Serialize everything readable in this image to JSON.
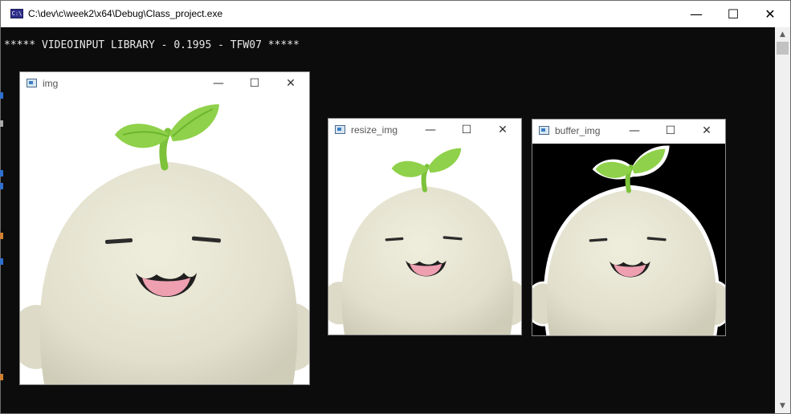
{
  "console": {
    "title": "C:\\dev\\c\\week2\\x64\\Debug\\Class_project.exe",
    "icon": "console-app-icon",
    "minimize_glyph": "—",
    "maximize_glyph": "☐",
    "close_glyph": "✕",
    "output_line": "***** VIDEOINPUT LIBRARY - 0.1995 - TFW07 *****",
    "background_color": "#0c0c0c",
    "text_color": "#e8e8e8"
  },
  "scrollbar": {
    "up_glyph": "▲",
    "down_glyph": "▼"
  },
  "windows": [
    {
      "title": "img",
      "icon": "image-window-icon",
      "background": "white"
    },
    {
      "title": "resize_img",
      "icon": "image-window-icon",
      "background": "white"
    },
    {
      "title": "buffer_img",
      "icon": "image-window-icon",
      "background": "black"
    }
  ],
  "window_controls": {
    "minimize": "—",
    "maximize": "☐",
    "close": "✕"
  },
  "image_subject": "white plush sprout mascot with green leaf"
}
